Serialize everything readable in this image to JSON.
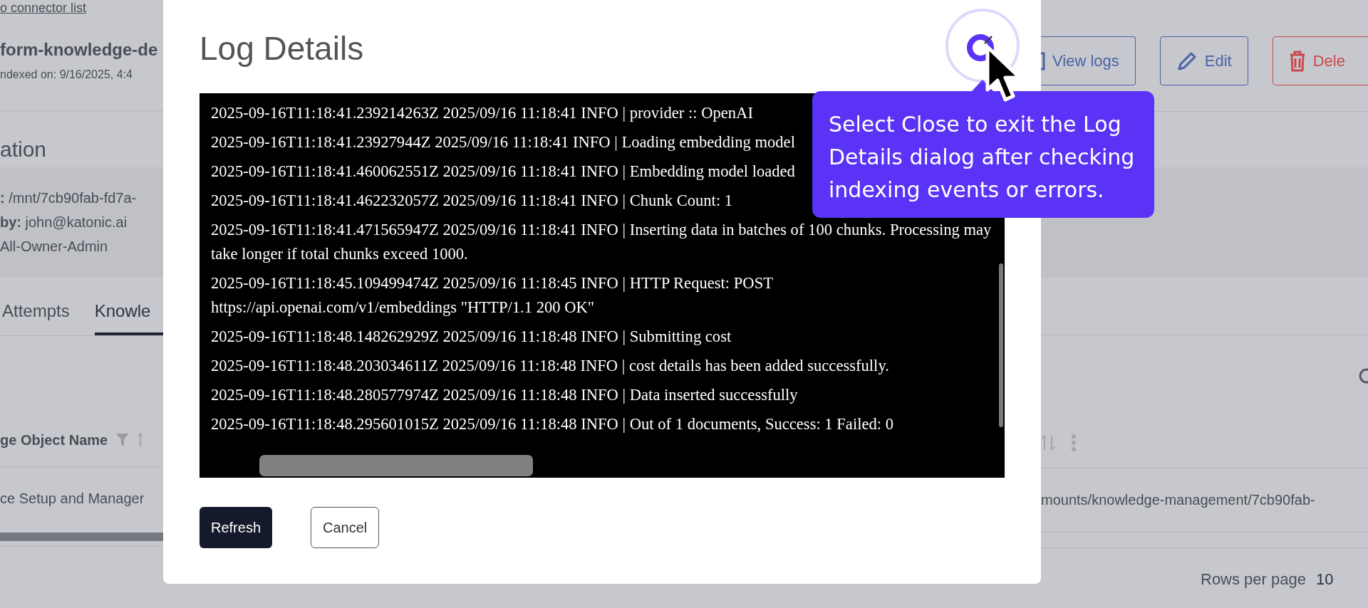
{
  "background_page": {
    "back_link": "o connector list",
    "connector_name": "form-knowledge-de",
    "indexed_on": "ndexed on: 9/16/2025, 4:4",
    "section_title": "ation",
    "details": [
      "**:** /mnt/7cb90fab-fd7a-",
      "**by:** john@katonic.ai",
      "All-Owner-Admin"
    ],
    "actions": [
      {
        "label": "View logs",
        "kind": "logs"
      },
      {
        "label": "Edit",
        "kind": "edit"
      },
      {
        "label": "Dele",
        "kind": "delete"
      }
    ],
    "tabs": [
      {
        "label": "Attempts",
        "selected": false
      },
      {
        "label": "Knowle",
        "selected": true
      }
    ],
    "table": {
      "columns": [
        "ge Object Name"
      ],
      "rows": [
        {
          "cells": [
            "ce Setup and Manager",
            "mounts/knowledge-management/7cb90fab-"
          ]
        }
      ]
    },
    "pagination": {
      "label": "Rows per page",
      "rows_per_page": "10"
    }
  },
  "dialog": {
    "title": "Log Details",
    "log_lines": [
      "2025-09-16T11:18:41.239214263Z 2025/09/16 11:18:41 INFO | provider :: OpenAI",
      "2025-09-16T11:18:41.23927944Z 2025/09/16 11:18:41 INFO | Loading embedding model",
      "2025-09-16T11:18:41.460062551Z 2025/09/16 11:18:41 INFO | Embedding model loaded",
      "2025-09-16T11:18:41.462232057Z 2025/09/16 11:18:41 INFO | Chunk Count: 1",
      "2025-09-16T11:18:41.471565947Z 2025/09/16 11:18:41 INFO | Inserting data in batches of 100 chunks. Processing may take longer if total chunks exceed 1000.",
      "2025-09-16T11:18:45.109499474Z 2025/09/16 11:18:45 INFO | HTTP Request: POST https://api.openai.com/v1/embeddings \"HTTP/1.1 200 OK\"",
      "2025-09-16T11:18:48.148262929Z 2025/09/16 11:18:48 INFO | Submitting cost",
      "2025-09-16T11:18:48.203034611Z 2025/09/16 11:18:48 INFO | cost details has been added successfully.",
      "2025-09-16T11:18:48.280577974Z 2025/09/16 11:18:48 INFO | Data inserted successfully",
      "2025-09-16T11:18:48.295601015Z 2025/09/16 11:18:48 INFO | Out of 1 documents, Success: 1 Failed: 0"
    ],
    "buttons": [
      {
        "label": "Refresh",
        "kind": "primary"
      },
      {
        "label": "Cancel",
        "kind": "secondary"
      }
    ]
  },
  "tooltip": {
    "text": "Select Close to exit the Log Details dialog after checking indexing events or errors."
  }
}
